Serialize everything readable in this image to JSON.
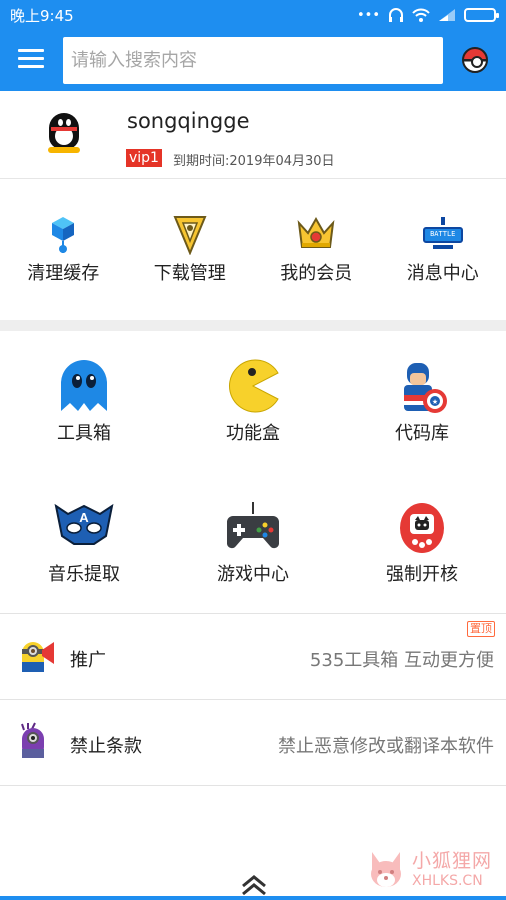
{
  "status_bar": {
    "time": "晚上9:45",
    "icons": [
      "dots-icon",
      "headphones-icon",
      "wifi-icon",
      "signal-icon",
      "battery-icon"
    ],
    "battery_level": 0
  },
  "app_bar": {
    "menu_icon": "hamburger-menu-icon",
    "search_placeholder": "请输入搜索内容",
    "action_icon": "pokeball-icon"
  },
  "profile": {
    "username": "songqingge",
    "vip": "vip1",
    "expire": "到期时间:2019年04月30日",
    "avatar_icon": "qq-penguin-icon"
  },
  "quick_actions": [
    {
      "label": "清理缓存",
      "icon": "cube-node-icon"
    },
    {
      "label": "下载管理",
      "icon": "triangle-badge-icon"
    },
    {
      "label": "我的会员",
      "icon": "crown-icon"
    },
    {
      "label": "消息中心",
      "icon": "battle-badge-icon",
      "icon_text": "BATTLE"
    }
  ],
  "tools": [
    {
      "label": "工具箱",
      "icon": "blue-ghost-icon"
    },
    {
      "label": "功能盒",
      "icon": "pacman-icon"
    },
    {
      "label": "代码库",
      "icon": "captain-america-icon"
    },
    {
      "label": "音乐提取",
      "icon": "captain-mask-icon",
      "icon_text": "A"
    },
    {
      "label": "游戏中心",
      "icon": "gamepad-icon"
    },
    {
      "label": "强制开核",
      "icon": "tamagotchi-icon"
    }
  ],
  "rows": [
    {
      "title": "推广",
      "desc": "535工具箱 互动更方便",
      "badge": "置顶",
      "icon": "minion-megaphone-icon"
    },
    {
      "title": "禁止条款",
      "desc": "禁止恶意修改或翻译本软件",
      "icon": "purple-minion-icon"
    }
  ],
  "watermark": {
    "cn": "小狐狸网",
    "en": "XHLKS.CN"
  },
  "colors": {
    "primary": "#1e8ef0",
    "vip_red": "#e53427",
    "badge_orange": "#ff6a3d"
  }
}
